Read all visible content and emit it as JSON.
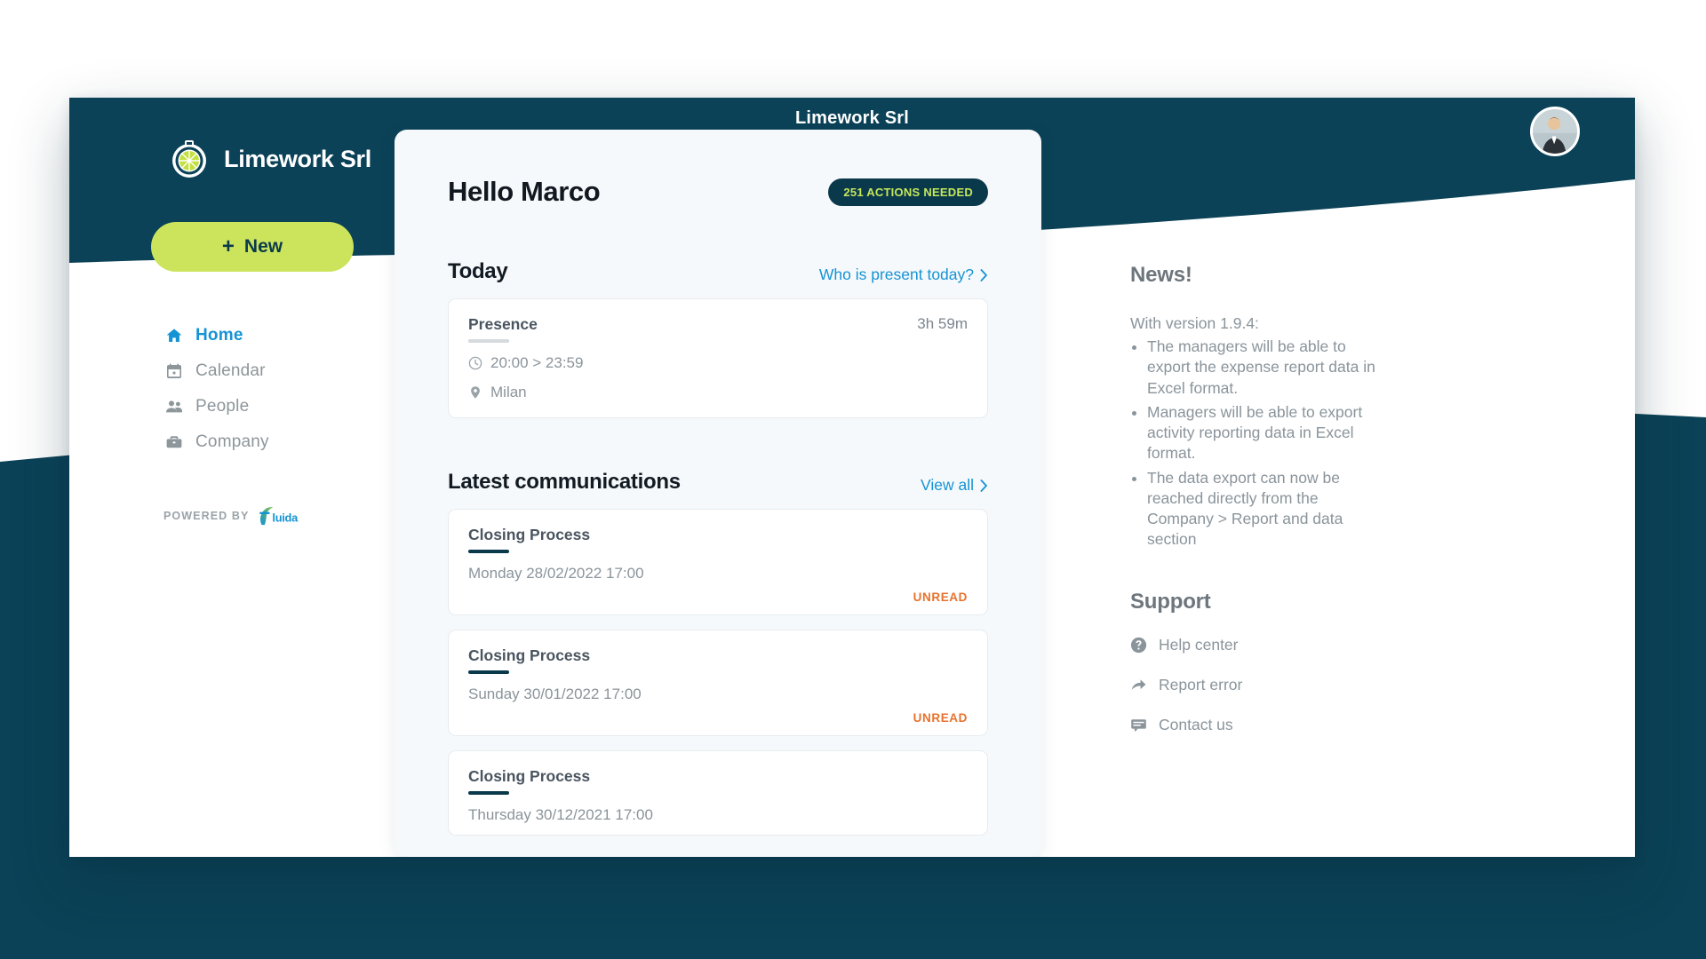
{
  "colors": {
    "navy": "#0b4257",
    "navy_dark": "#0b394c",
    "lime": "#cbe45c",
    "blue_link": "#1593d4",
    "orange": "#e8722c",
    "card_bg": "#f6f9fb",
    "muted": "#8a949b"
  },
  "window": {
    "header_title": "Limework Srl",
    "avatar_alt": "user-avatar"
  },
  "brand": {
    "name": "Limework Srl",
    "logo_icon": "lime-stopwatch-logo"
  },
  "sidebar": {
    "new_button": {
      "plus": "+",
      "label": "New"
    },
    "nav": [
      {
        "label": "Home",
        "icon": "home-icon",
        "active": true
      },
      {
        "label": "Calendar",
        "icon": "calendar-icon",
        "active": false
      },
      {
        "label": "People",
        "icon": "people-icon",
        "active": false
      },
      {
        "label": "Company",
        "icon": "briefcase-icon",
        "active": false
      }
    ],
    "powered_by": {
      "label": "POWERED BY",
      "brand": "fluida"
    }
  },
  "main": {
    "greeting": "Hello Marco",
    "actions_badge": "251 ACTIONS NEEDED",
    "today": {
      "title": "Today",
      "link": "Who is present today?",
      "presence": {
        "name": "Presence",
        "duration": "3h 59m",
        "time_range": "20:00 > 23:59",
        "location": "Milan",
        "clock_icon": "clock-icon",
        "pin_icon": "location-pin-icon"
      }
    },
    "communications": {
      "title": "Latest communications",
      "link": "View all",
      "items": [
        {
          "title": "Closing Process",
          "date": "Monday 28/02/2022 17:00",
          "status": "UNREAD"
        },
        {
          "title": "Closing Process",
          "date": "Sunday 30/01/2022 17:00",
          "status": "UNREAD"
        },
        {
          "title": "Closing Process",
          "date": "Thursday 30/12/2021 17:00",
          "status": ""
        }
      ]
    }
  },
  "rail": {
    "news": {
      "title": "News!",
      "intro": "With version 1.9.4:",
      "items": [
        "The managers will be able to export the expense report data in Excel format.",
        "Managers will be able to export activity reporting data in Excel format.",
        "The data export can now be reached directly from the Company > Report and data section"
      ]
    },
    "support": {
      "title": "Support",
      "items": [
        {
          "label": "Help center",
          "icon": "help-circle-icon"
        },
        {
          "label": "Report error",
          "icon": "share-arrow-icon"
        },
        {
          "label": "Contact us",
          "icon": "chat-bubble-icon"
        }
      ]
    }
  }
}
